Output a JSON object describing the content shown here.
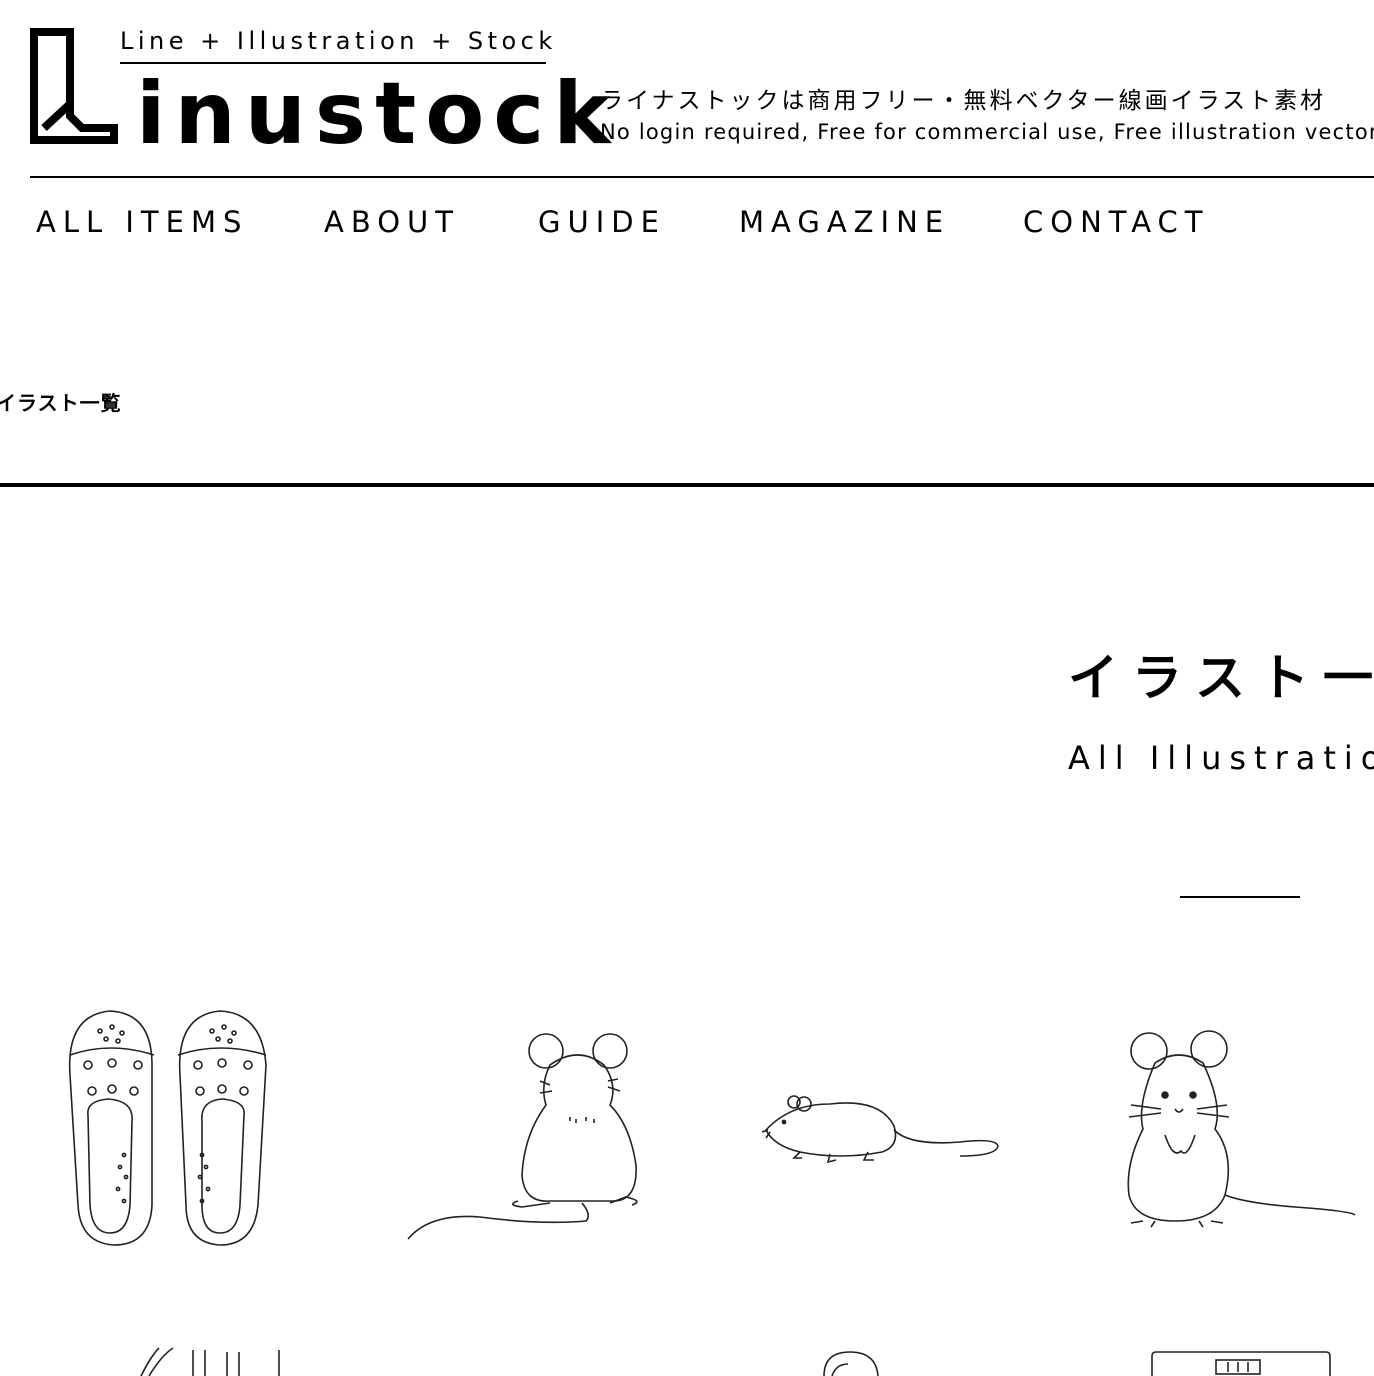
{
  "header": {
    "tagline": "Line + Illustration + Stock",
    "wordmark": "inustock",
    "description_ja": "ライナストックは商用フリー・無料ベクター線画イラスト素材",
    "description_en": "No login required, Free for commercial use, Free illustration vector"
  },
  "nav": {
    "items": [
      "ALL ITEMS",
      "ABOUT",
      "GUIDE",
      "MAGAZINE",
      "CONTACT"
    ]
  },
  "breadcrumb": {
    "current": "イラスト一覧"
  },
  "main": {
    "title_ja": "イラスト一覧",
    "title_en": "All Illustrations"
  },
  "grid": {
    "items": [
      {
        "icon": "sandals-illustration"
      },
      {
        "icon": "rat-back-illustration"
      },
      {
        "icon": "mouse-walking-illustration"
      },
      {
        "icon": "mouse-standing-illustration"
      },
      {
        "icon": "hair-illustration"
      },
      {
        "icon": "blank-illustration"
      },
      {
        "icon": "person-head-illustration"
      },
      {
        "icon": "device-illustration"
      }
    ]
  }
}
